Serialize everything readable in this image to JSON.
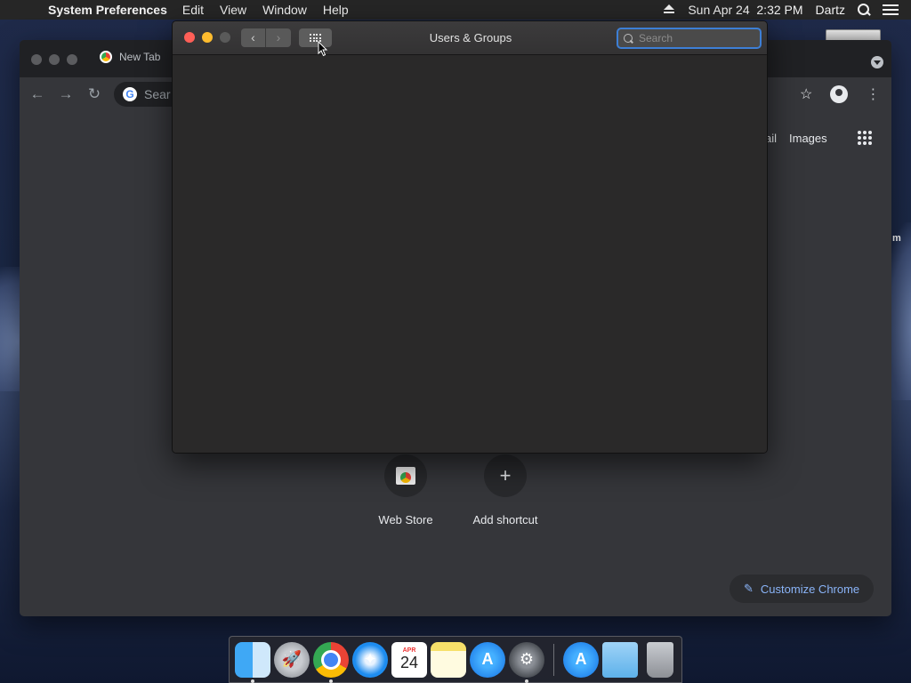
{
  "menubar": {
    "app_name": "System Preferences",
    "menus": [
      "Edit",
      "View",
      "Window",
      "Help"
    ],
    "datetime": "Sun Apr 24  2:32 PM",
    "user": "Dartz"
  },
  "desktop": {
    "partial_label": "m"
  },
  "chrome": {
    "tab_title": "New Tab",
    "omnibox_placeholder": "Sear",
    "top_links": [
      "ail",
      "Images"
    ],
    "shortcuts": [
      {
        "label": "Web Store"
      },
      {
        "label": "Add shortcut",
        "glyph": "+"
      }
    ],
    "customize_label": "Customize Chrome"
  },
  "sysprefs": {
    "title": "Users & Groups",
    "search_placeholder": "Search"
  },
  "dock": {
    "calendar_month": "APR",
    "calendar_day": "24"
  },
  "colors": {
    "close": "#ff5f57",
    "minimize": "#febc2e",
    "search_focus": "#3d7fd6",
    "customize_text": "#8ab4f8"
  }
}
